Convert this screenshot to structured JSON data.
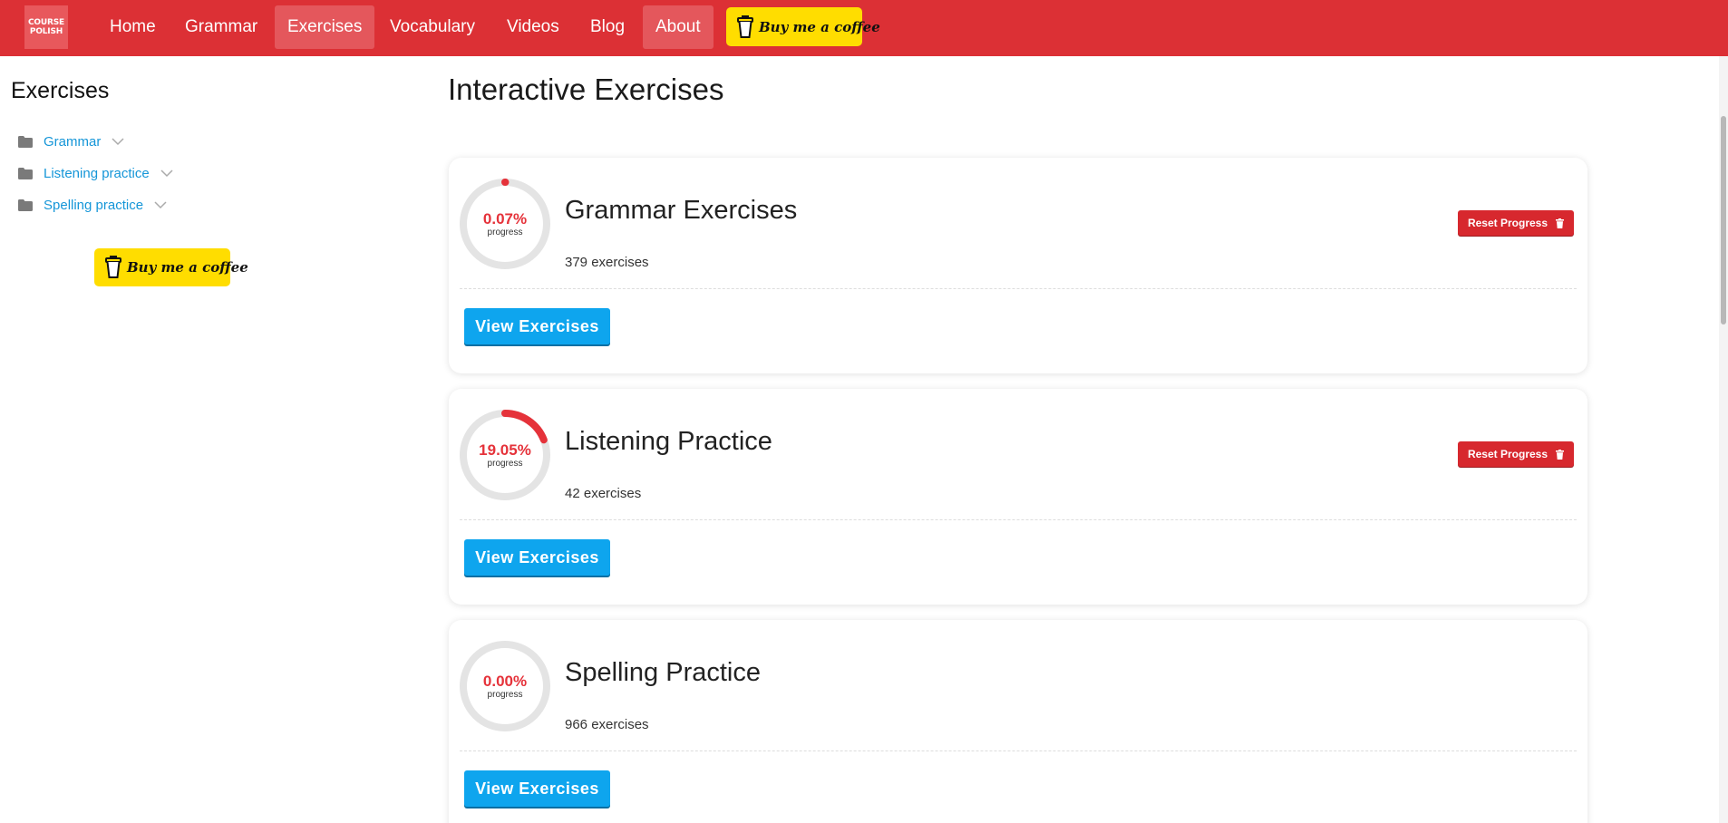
{
  "navbar": {
    "logo_line1": "COURSE",
    "logo_line2": "POLISH",
    "items": [
      {
        "label": "Home",
        "active": false
      },
      {
        "label": "Grammar",
        "active": false
      },
      {
        "label": "Exercises",
        "active": true
      },
      {
        "label": "Vocabulary",
        "active": false
      },
      {
        "label": "Videos",
        "active": false
      },
      {
        "label": "Blog",
        "active": false
      },
      {
        "label": "About",
        "active": true
      }
    ],
    "coffee_label": "Buy me a coffee"
  },
  "sidebar": {
    "title": "Exercises",
    "items": [
      {
        "label": "Grammar"
      },
      {
        "label": "Listening practice"
      },
      {
        "label": "Spelling practice"
      }
    ],
    "coffee_label": "Buy me a coffee"
  },
  "main": {
    "title": "Interactive Exercises",
    "cards": [
      {
        "title": "Grammar Exercises",
        "progress_text": "0.07%",
        "progress_value": 0.07,
        "progress_label": "progress",
        "count": "379 exercises",
        "view_label": "View Exercises",
        "reset_label": "Reset Progress",
        "has_reset": true
      },
      {
        "title": "Listening Practice",
        "progress_text": "19.05%",
        "progress_value": 19.05,
        "progress_label": "progress",
        "count": "42 exercises",
        "view_label": "View Exercises",
        "reset_label": "Reset Progress",
        "has_reset": true
      },
      {
        "title": "Spelling Practice",
        "progress_text": "0.00%",
        "progress_value": 0.0,
        "progress_label": "progress",
        "count": "966 exercises",
        "view_label": "View Exercises",
        "has_reset": false
      }
    ]
  },
  "colors": {
    "navbar": "#dc3035",
    "accent_blue": "#0ea5ee",
    "progress_red": "#e5323a",
    "reset_red": "#d7282e",
    "coffee_yellow": "#ffdd00"
  }
}
